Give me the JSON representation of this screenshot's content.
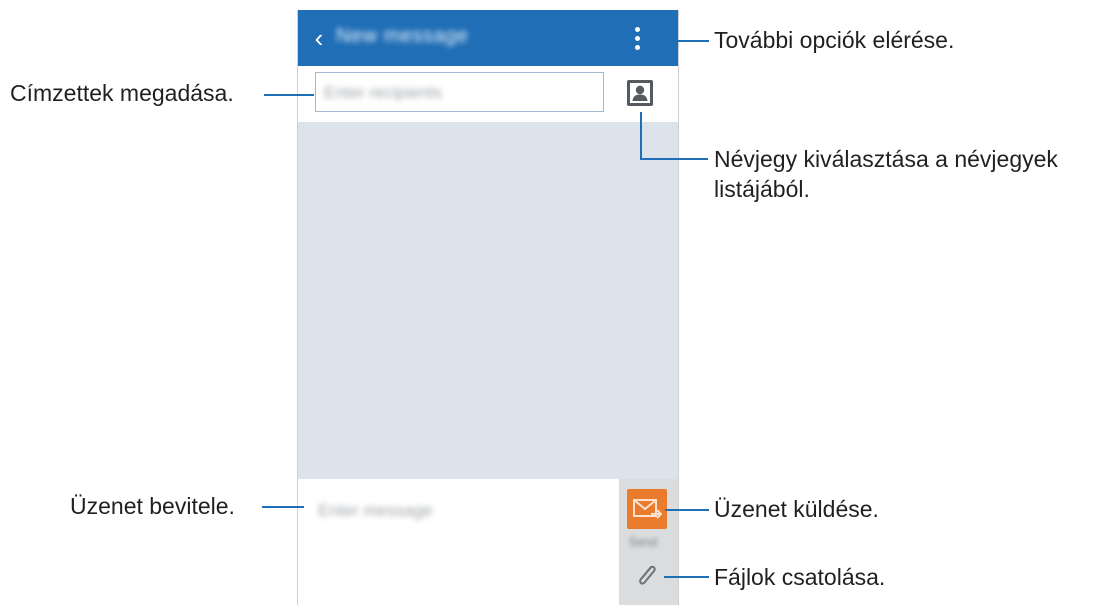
{
  "phone": {
    "app_bar": {
      "title": "New message",
      "back_icon": "chevron-left-icon",
      "more_icon": "more-vert-icon"
    },
    "recipient": {
      "placeholder": "Enter recipients",
      "contact_icon": "contact-person-icon"
    },
    "compose": {
      "placeholder": "Enter message",
      "send_icon": "envelope-send-icon",
      "send_sublabel": "Send",
      "attach_icon": "paperclip-icon"
    },
    "colors": {
      "app_bar": "#1f6eb6",
      "conversation_bg": "#dce3ea",
      "send_button": "#ea7a2c",
      "callout_line": "#1f6eb6"
    }
  },
  "callouts": {
    "more_options": "További opciók elérése.",
    "recipients": "Címzettek megadása.",
    "contacts": "Névjegy kiválasztása a névjegyek listájából.",
    "contacts_line1": "Névjegy kiválasztása a névjegyek",
    "contacts_line2": "listájából.",
    "message_input": "Üzenet bevitele.",
    "send": "Üzenet küldése.",
    "attach": "Fájlok csatolása."
  }
}
